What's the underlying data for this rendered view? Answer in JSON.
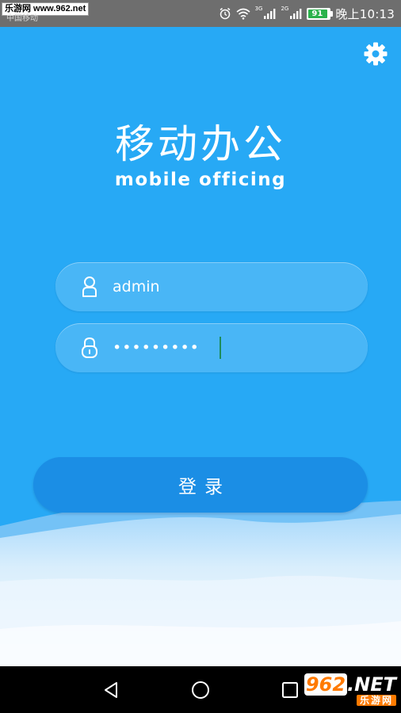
{
  "status_bar": {
    "watermark": "乐游网 www.962.net",
    "carrier": "中国移动",
    "net1": "3G",
    "net2": "2G",
    "battery": "91",
    "time": "晚上10:13"
  },
  "header": {
    "title_cn": "移动办公",
    "title_en": "mobile officing"
  },
  "login_form": {
    "username_value": "admin",
    "password_value": "•••••••••",
    "login_label": "登录"
  },
  "nav_bar": {
    "watermark_number": "962",
    "watermark_domain": ".NET",
    "watermark_sub": "乐游网"
  },
  "colors": {
    "background": "#27a9f5",
    "button": "#1b8ee5",
    "status_bar": "#6e6e6e",
    "nav_bar": "#000000",
    "watermark_accent": "#ff7a00"
  },
  "icons": {
    "settings": "gear-icon",
    "username": "user-icon",
    "password": "lock-icon",
    "back": "back-triangle-icon",
    "home": "home-circle-icon",
    "recent": "recent-square-icon"
  }
}
